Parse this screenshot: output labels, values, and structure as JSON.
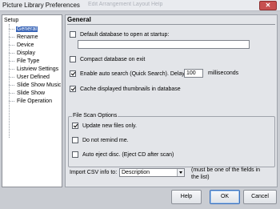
{
  "window": {
    "title": "Picture Library Preferences",
    "ghost_text": "Edit    Arrangement    Layout    Help",
    "close_glyph": "✕"
  },
  "tree": {
    "root": "Setup",
    "items": [
      {
        "label": "General",
        "selected": true
      },
      {
        "label": "Rename"
      },
      {
        "label": "Device"
      },
      {
        "label": "Display"
      },
      {
        "label": "File Type"
      },
      {
        "label": "Listview Settings"
      },
      {
        "label": "User Defined"
      },
      {
        "label": "Slide Show Music"
      },
      {
        "label": "Slide Show"
      },
      {
        "label": "File Operation"
      }
    ]
  },
  "general": {
    "heading": "General",
    "default_db_label": "Default database to open at startup:",
    "default_db_value": "",
    "compact_label": "Compact database on exit",
    "auto_search_label": "Enable auto search (Quick Search).  Delay:",
    "delay_value": "100",
    "delay_unit": "milliseconds",
    "cache_label": "Cache displayed thumbnails in database",
    "file_scan": {
      "legend": "File Scan Options",
      "update_label": "Update new files only.",
      "remind_label": "Do not remind me.",
      "eject_label": "Auto eject disc. (Eject CD after scan)"
    },
    "import_label": "Import CSV info to:",
    "import_value": "Description",
    "import_note_1": "(must be one of the fields in",
    "import_note_2": "the list)"
  },
  "buttons": {
    "help": "Help",
    "ok": "OK",
    "cancel": "Cancel"
  },
  "checkbox_states": {
    "default_db": false,
    "compact": false,
    "auto_search": true,
    "cache": true,
    "update_new": true,
    "do_not_remind": false,
    "auto_eject": false
  }
}
